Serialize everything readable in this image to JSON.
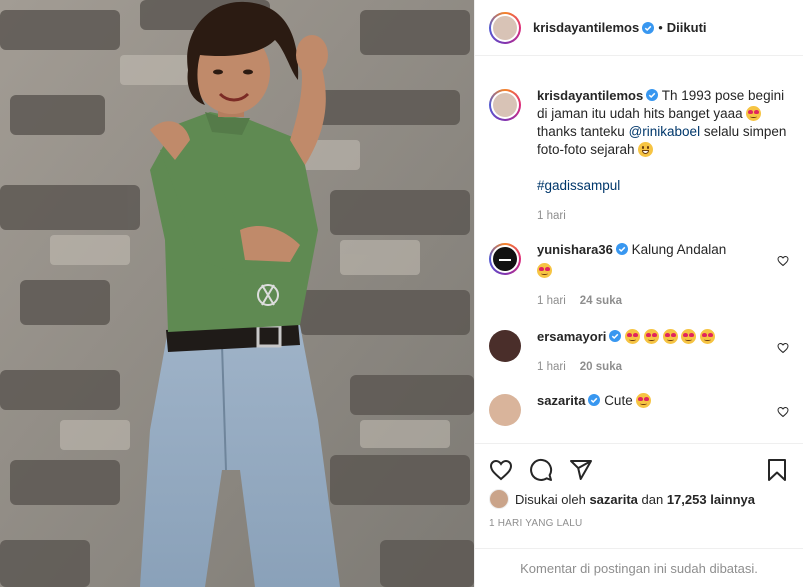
{
  "header": {
    "username": "krisdayantilemos",
    "separator": "•",
    "follow_state": "Diikuti"
  },
  "caption": {
    "username": "krisdayantilemos",
    "text_1": "Th 1993 pose begini di jaman itu udah hits banget yaaa",
    "text_2": "thanks tanteku",
    "mention": "@rinikaboel",
    "text_3": "selalu simpen foto-foto sejarah",
    "hashtag": "#gadissampul",
    "time": "1 hari"
  },
  "comments": [
    {
      "username": "yunishara36",
      "text": "Kalung Andalan",
      "time": "1 hari",
      "likes": "24 suka"
    },
    {
      "username": "ersamayori",
      "text": "",
      "time": "1 hari",
      "likes": "20 suka"
    },
    {
      "username": "sazarita",
      "text": "Cute"
    }
  ],
  "likes": {
    "prefix": "Disukai oleh",
    "user": "sazarita",
    "joiner": "dan",
    "others": "17,253 lainnya"
  },
  "post_date": "1 HARI YANG LALU",
  "comments_disabled": "Komentar di postingan ini sudah dibatasi.",
  "icons": {
    "verified": "verified-badge-icon",
    "like": "heart-icon",
    "comment": "comment-icon",
    "share": "paper-plane-icon",
    "save": "bookmark-icon"
  },
  "colors": {
    "verified_blue": "#3897f0",
    "link": "#00376b",
    "muted": "#8e8e8e"
  }
}
